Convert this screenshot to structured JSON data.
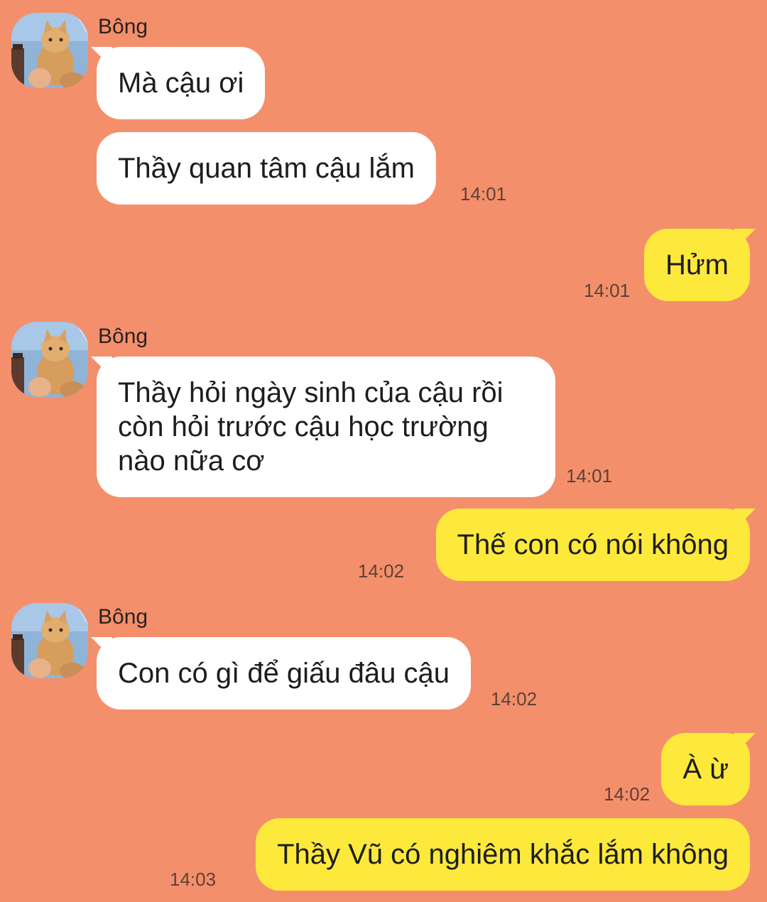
{
  "colors": {
    "background": "#f48f6c",
    "incoming_bubble": "#ffffff",
    "outgoing_bubble": "#fde93b"
  },
  "contact": {
    "name": "Bông",
    "avatar_icon": "cat-avatar-icon"
  },
  "messages": [
    {
      "text": "Mà cậu ơi",
      "time": ""
    },
    {
      "text": "Thầy quan tâm cậu lắm",
      "time": "14:01"
    },
    {
      "text": "Hửm",
      "time": "14:01"
    },
    {
      "text": "Thầy hỏi ngày sinh của cậu rồi còn hỏi trước cậu học trường nào nữa cơ",
      "time": "14:01"
    },
    {
      "text": "Thế con có nói không",
      "time": "14:02"
    },
    {
      "text": "Con có gì để giấu đâu cậu",
      "time": "14:02"
    },
    {
      "text": "À ừ",
      "time": "14:02"
    },
    {
      "text": "Thầy Vũ có nghiêm khắc lắm không",
      "time": "14:03"
    }
  ]
}
